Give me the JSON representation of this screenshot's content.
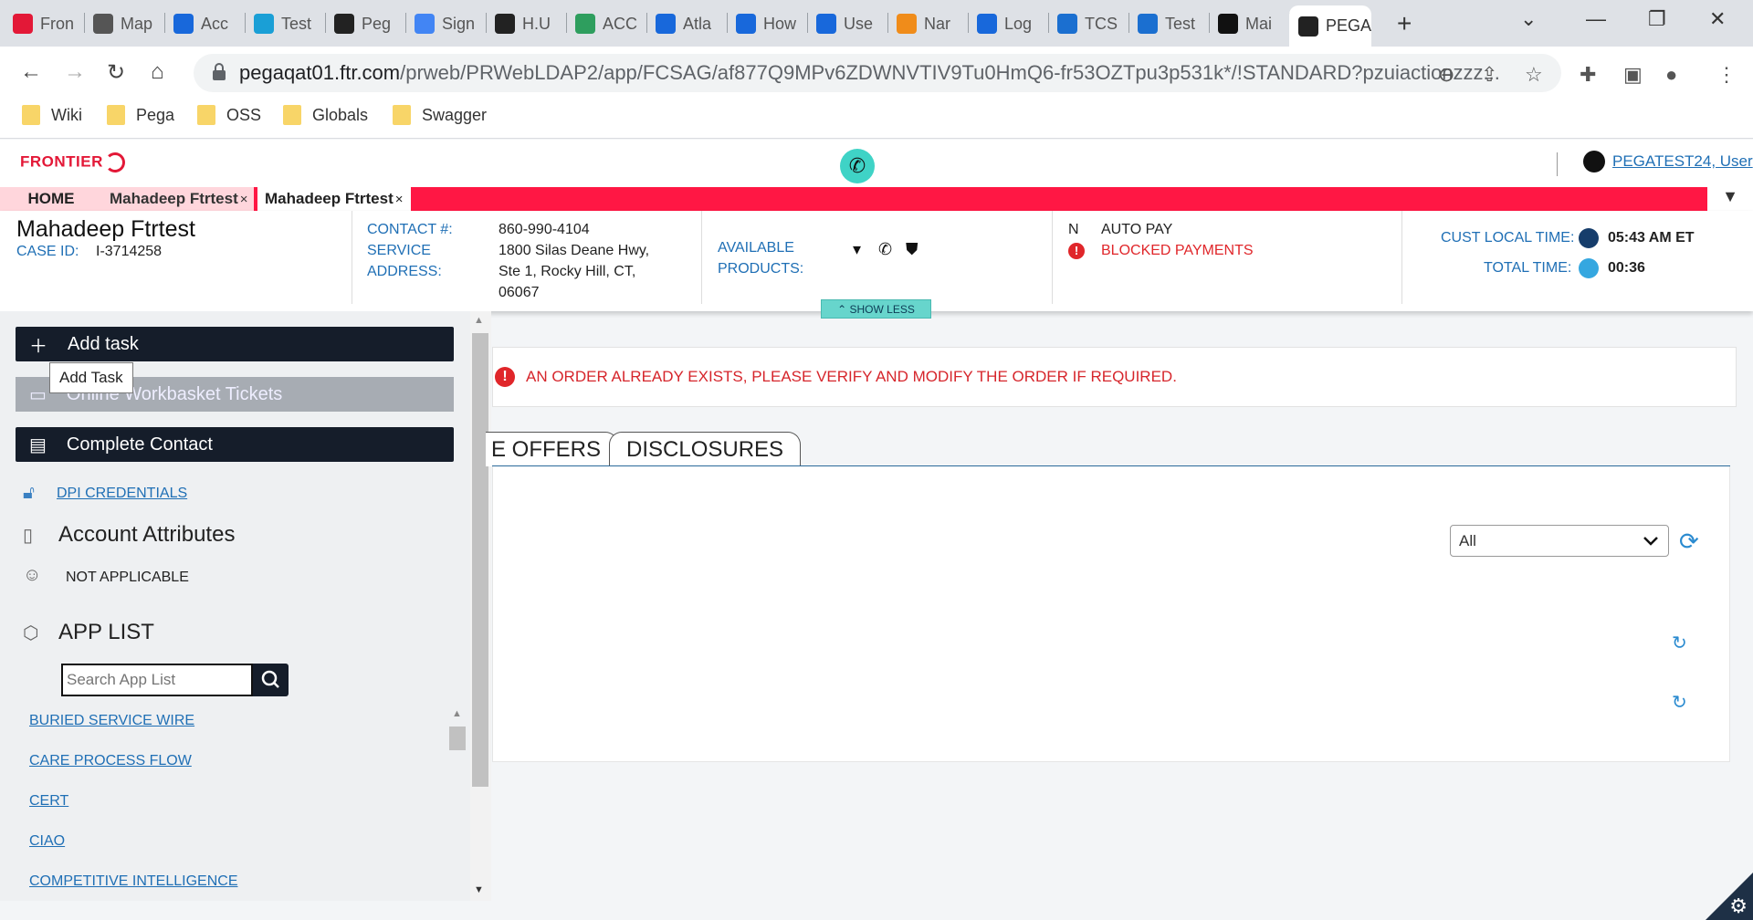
{
  "browser": {
    "tabs": [
      {
        "label": "Fron",
        "icon": "frontier-icon",
        "color": "#e31837"
      },
      {
        "label": "Map",
        "icon": "globe-icon",
        "color": "#555555"
      },
      {
        "label": "Acc",
        "icon": "jira-icon",
        "color": "#1868db"
      },
      {
        "label": "Test",
        "icon": "feather-icon",
        "color": "#1a9fd6"
      },
      {
        "label": "Peg",
        "icon": "pega-icon",
        "color": "#222222"
      },
      {
        "label": "Sign",
        "icon": "google-icon",
        "color": "#4285f4"
      },
      {
        "label": "H.U",
        "icon": "pega-icon",
        "color": "#222222"
      },
      {
        "label": "ACC",
        "icon": "q-icon",
        "color": "#2e9e5e"
      },
      {
        "label": "Atla",
        "icon": "jira-icon",
        "color": "#1868db"
      },
      {
        "label": "How",
        "icon": "atlassian-icon",
        "color": "#1868db"
      },
      {
        "label": "Use",
        "icon": "jira-icon",
        "color": "#1868db"
      },
      {
        "label": "Nar",
        "icon": "mask-icon",
        "color": "#f08c1a"
      },
      {
        "label": "Log",
        "icon": "atlassian-icon",
        "color": "#1868db"
      },
      {
        "label": "TCS",
        "icon": "cloud-icon",
        "color": "#1b6fd0"
      },
      {
        "label": "Test",
        "icon": "cloud-icon",
        "color": "#1b6fd0"
      },
      {
        "label": "Mai",
        "icon": "github-icon",
        "color": "#111111"
      },
      {
        "label": "PEGA",
        "icon": "pega-icon",
        "color": "#222222",
        "active": true
      }
    ],
    "new_tab": "+",
    "url_host": "pegaqat01.ftr.com",
    "url_path": "/prweb/PRWebLDAP2/app/FCSAG/af877Q9MPv6ZDWNVTIV9Tu0HmQ6-fr53OZTpu3p531k*/!STANDARD?pzuiactionzzz...",
    "bookmarks": [
      "Wiki",
      "Pega",
      "OSS",
      "Globals",
      "Swagger"
    ]
  },
  "header": {
    "logo": "FRONTIER",
    "user_name": "PEGATEST24, User"
  },
  "app_tabs": {
    "home": "HOME",
    "tab1": "Mahadeep Ftrtest",
    "tab2": "Mahadeep Ftrtest",
    "close": "×"
  },
  "customer": {
    "name": "Mahadeep Ftrtest",
    "case_id_label": "CASE ID:",
    "case_id": "I-3714258",
    "contact_label": "CONTACT #:",
    "contact": "860-990-4104",
    "service_label_1": "SERVICE",
    "service_label_2": "ADDRESS:",
    "address_1": "1800 Silas Deane Hwy,",
    "address_2": "Ste 1, Rocky Hill, CT,",
    "address_3": "06067",
    "products_label_1": "AVAILABLE",
    "products_label_2": "PRODUCTS:",
    "autopay_flag": "N",
    "autopay_label": "AUTO PAY",
    "blocked_label": "BLOCKED PAYMENTS",
    "local_time_label": "CUST LOCAL TIME:",
    "local_time": "05:43 AM ET",
    "total_time_label": "TOTAL TIME:",
    "total_time": "00:36",
    "show_less": "SHOW LESS"
  },
  "sidebar": {
    "add_task": "Add task",
    "tooltip": "Add Task",
    "workbasket": "Online Workbasket Tickets",
    "complete_contact": "Complete Contact",
    "dpi_credentials": "DPI CREDENTIALS",
    "account_attributes": "Account Attributes",
    "not_applicable": "NOT APPLICABLE",
    "app_list_title": "APP LIST",
    "search_placeholder": "Search App List",
    "apps": [
      "BURIED SERVICE WIRE",
      "CARE PROCESS FLOW",
      "CERT",
      "CIAO",
      "COMPETITIVE INTELLIGENCE"
    ]
  },
  "main": {
    "alert": "AN ORDER ALREADY EXISTS, PLEASE VERIFY AND MODIFY THE ORDER IF REQUIRED.",
    "tabs": [
      "E OFFERS",
      "DISCLOSURES"
    ],
    "filter_value": "All"
  },
  "colors": {
    "accent_red": "#ff1744",
    "teal": "#3fd3c6",
    "navy": "#151d2a",
    "link_blue": "#1f6fb5"
  }
}
